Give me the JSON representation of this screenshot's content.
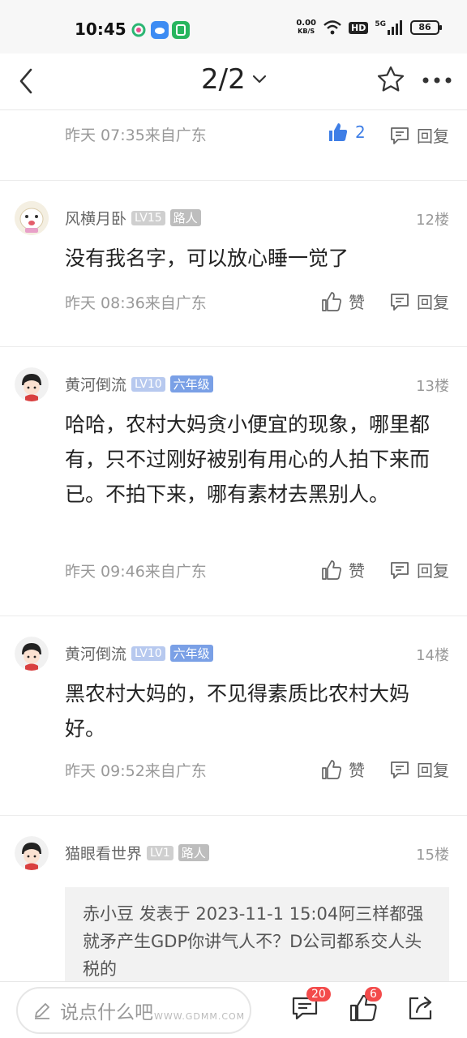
{
  "status_bar": {
    "time": "10:45",
    "net_speed_value": "0.00",
    "net_speed_unit": "KB/S",
    "hd": "HD",
    "signal": "5G",
    "battery": "86"
  },
  "nav": {
    "page": "2/2"
  },
  "posts": [
    {
      "time": "昨天 07:35来自广东",
      "like_label": "2",
      "reply_label": "回复"
    },
    {
      "username": "风横月卧",
      "level": "LV15",
      "title": "路人",
      "floor": "12楼",
      "text": "没有我名字，可以放心睡一觉了",
      "time": "昨天 08:36来自广东",
      "like_label": "赞",
      "reply_label": "回复"
    },
    {
      "username": "黄河倒流",
      "level": "LV10",
      "title": "六年级",
      "floor": "13楼",
      "text": "哈哈，农村大妈贪小便宜的现象，哪里都有，只不过刚好被别有用心的人拍下来而已。不拍下来，哪有素材去黑别人。",
      "time": "昨天 09:46来自广东",
      "like_label": "赞",
      "reply_label": "回复"
    },
    {
      "username": "黄河倒流",
      "level": "LV10",
      "title": "六年级",
      "floor": "14楼",
      "text": "黑农村大妈的，不见得素质比农村大妈好。",
      "time": "昨天 09:52来自广东",
      "like_label": "赞",
      "reply_label": "回复"
    },
    {
      "username": "猫眼看世界",
      "level": "LV1",
      "title": "路人",
      "floor": "15楼",
      "quote": "赤小豆 发表于 2023-11-1 15:04阿三样都强就矛产生GDP你讲气人不？D公司都系交人头税的"
    }
  ],
  "bottom_bar": {
    "input_placeholder": "说点什么吧",
    "comment_count": "20",
    "like_count": "6",
    "watermark": "WWW.GDMM.COM"
  },
  "colors": {
    "accent_blue": "#3e7ee6",
    "badge_red": "#f34b4b"
  }
}
